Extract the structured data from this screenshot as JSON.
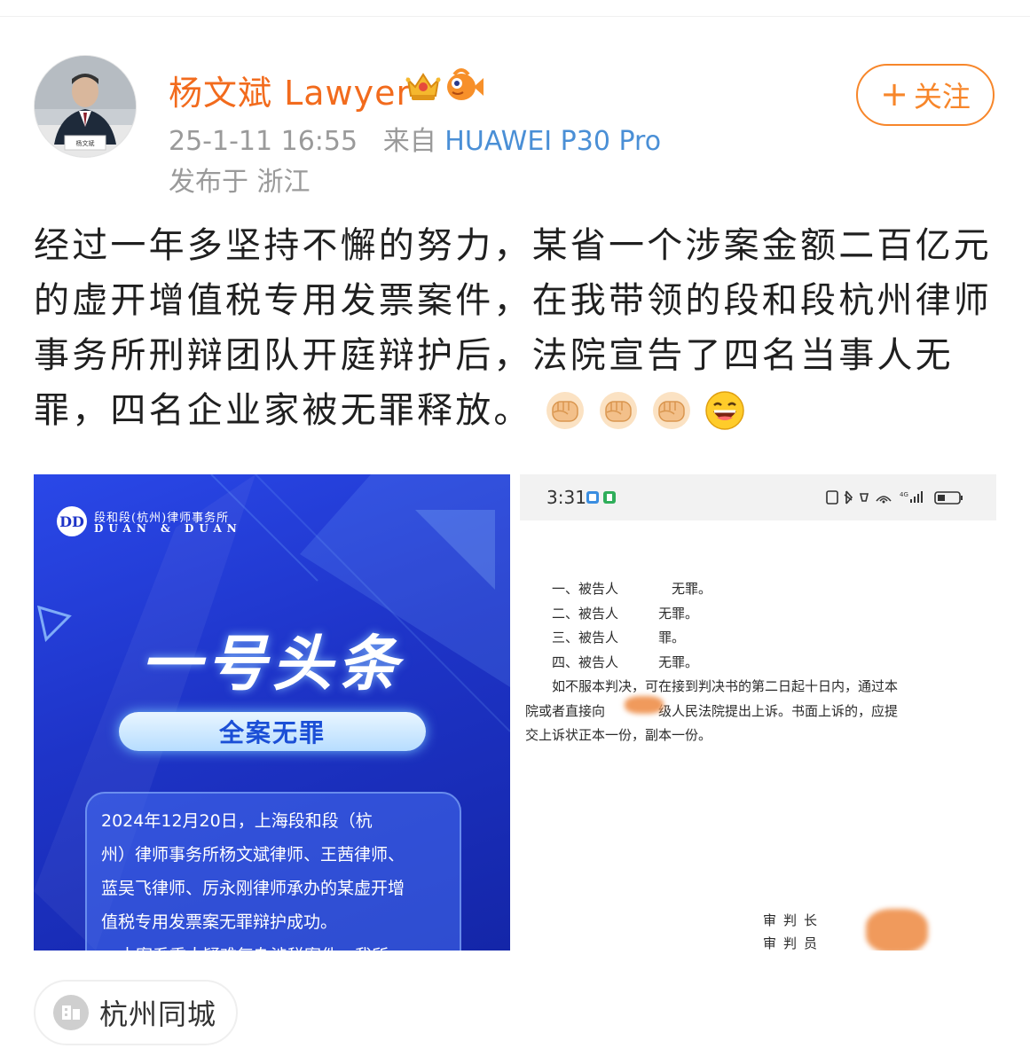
{
  "post": {
    "author": {
      "name": "杨文斌 Lawyer",
      "avatar_name_plate": "杨文斌"
    },
    "timestamp": "25-1-11 16:55",
    "source_prefix": "来自",
    "device": "HUAWEI P30 Pro",
    "published_in": "发布于 浙江",
    "follow_label": "关注",
    "follow_plus": "+",
    "text_lines": [
      "经过一年多坚持不懈的努力，某省一个涉案金额二百亿元",
      "的虚开增值税专用发票案件，在我带领的段和段杭州律师",
      "事务所刑辩团队开庭辩护后，法院宣告了四名当事人无",
      "罪，四名企业家被无罪释放。"
    ],
    "emojis": [
      "fist-emoji",
      "fist-emoji",
      "fist-emoji",
      "laughing-emoji"
    ],
    "location_tag": "杭州同城"
  },
  "image_left": {
    "logo_letters": "DD",
    "firm_cn": "段和段(杭州)律师事务所",
    "firm_en": "DUAN & DUAN",
    "headline": "一号头条",
    "pill_text": "全案无罪",
    "body_lines": [
      "2024年12月20日，上海段和段（杭",
      "州）律师事务所杨文斌律师、王茜律师、",
      "蓝吴飞律师、厉永刚律师承办的某虚开增",
      "值税专用发票案无罪辩护成功。",
      "本案系重大疑难复杂涉税案件，我所"
    ]
  },
  "image_right": {
    "status_time": "3:31",
    "doc_lines": [
      "　　一、被告人　　　　无罪。",
      "　　二、被告人　　　无罪。",
      "　　三、被告人　　　罪。",
      "　　四、被告人　　　无罪。",
      "　　如不服本判决，可在接到判决书的第二日起十日内，通过本",
      "院或者直接向　　　　级人民法院提出上诉。书面上诉的，应提",
      "交上诉状正本一份，副本一份。"
    ],
    "sign_lines": [
      "审判长",
      "审判员"
    ]
  }
}
